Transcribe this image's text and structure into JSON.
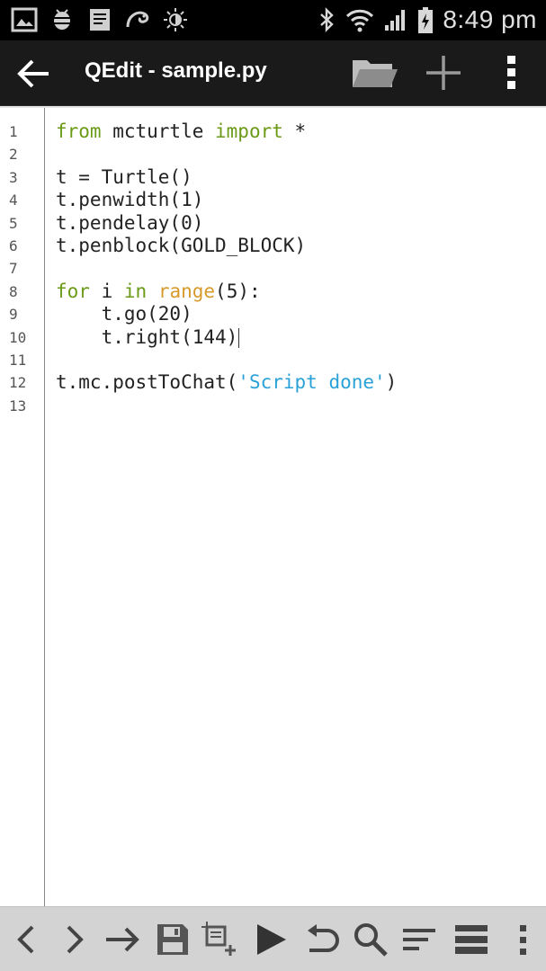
{
  "status_bar": {
    "time": "8:49 pm",
    "left_icons": [
      "gallery-icon",
      "android-debug-icon",
      "notes-icon",
      "chameleon-icon",
      "brightness-icon"
    ],
    "right_icons": [
      "bluetooth-icon",
      "wifi-icon",
      "signal-icon",
      "battery-charging-icon"
    ]
  },
  "action_bar": {
    "title": "QEdit - sample.py",
    "actions": [
      "back-arrow-icon",
      "folder-open-icon",
      "plus-icon",
      "overflow-menu-icon"
    ]
  },
  "editor": {
    "line_numbers": [
      "1",
      "2",
      "3",
      "4",
      "5",
      "6",
      "7",
      "8",
      "9",
      "10",
      "11",
      "12",
      "13"
    ],
    "cursor_line": 10,
    "lines": [
      [
        {
          "t": "from",
          "c": "kw"
        },
        {
          "t": " mcturtle ",
          "c": ""
        },
        {
          "t": "import",
          "c": "kw"
        },
        {
          "t": " *",
          "c": ""
        }
      ],
      [],
      [
        {
          "t": "t = Turtle()",
          "c": ""
        }
      ],
      [
        {
          "t": "t.penwidth(1)",
          "c": ""
        }
      ],
      [
        {
          "t": "t.pendelay(0)",
          "c": ""
        }
      ],
      [
        {
          "t": "t.penblock(GOLD_BLOCK)",
          "c": ""
        }
      ],
      [],
      [
        {
          "t": "for",
          "c": "kw"
        },
        {
          "t": " i ",
          "c": ""
        },
        {
          "t": "in",
          "c": "kw"
        },
        {
          "t": " ",
          "c": ""
        },
        {
          "t": "range",
          "c": "fn"
        },
        {
          "t": "(5):",
          "c": ""
        }
      ],
      [
        {
          "t": "    t.go(20)",
          "c": ""
        }
      ],
      [
        {
          "t": "    t.right(144)",
          "c": ""
        }
      ],
      [],
      [
        {
          "t": "t.mc.postToChat(",
          "c": ""
        },
        {
          "t": "'Script done'",
          "c": "str"
        },
        {
          "t": ")",
          "c": ""
        }
      ],
      []
    ]
  },
  "toolbar": {
    "buttons": [
      "chevron-left-icon",
      "chevron-right-icon",
      "arrow-right-icon",
      "save-icon",
      "add-block-icon",
      "play-icon",
      "undo-icon",
      "search-icon",
      "sort-lines-icon",
      "list-icon",
      "more-vert-icon"
    ]
  },
  "colors": {
    "keyword": "#6a9a16",
    "builtin": "#d79a2b",
    "string": "#2aa1d8",
    "action_bar": "#1a1a1a",
    "toolbar": "#d3d3d3"
  }
}
